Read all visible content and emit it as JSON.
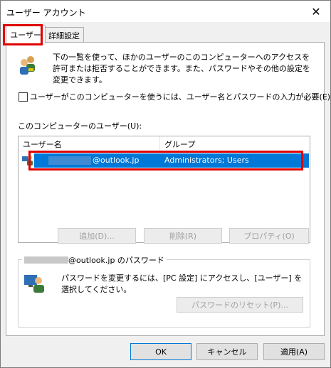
{
  "window": {
    "title": "ユーザー アカウント",
    "close_glyph": "✕"
  },
  "tabs": [
    {
      "label": "ユーザー",
      "active": true
    },
    {
      "label": "詳細設定",
      "active": false
    }
  ],
  "info_text": "下の一覧を使って、ほかのユーザーのこのコンピューターへのアクセスを許可または拒否することができます。また、パスワードやその他の設定を変更できます。",
  "require_login_checkbox": {
    "label": "ユーザーがこのコンピューターを使うには、ユーザー名とパスワードの入力が必要(E)",
    "checked": false
  },
  "users_section": {
    "label": "このコンピューターのユーザー(U):",
    "columns": [
      "ユーザー名",
      "グループ"
    ],
    "rows": [
      {
        "user_suffix": "@outlook.jp",
        "group": "Administrators; Users",
        "selected": true
      }
    ]
  },
  "list_buttons": {
    "add": "追加(D)...",
    "remove": "削除(R)",
    "properties": "プロパティ(O)"
  },
  "password_group": {
    "legend_suffix": "@outlook.jp のパスワード",
    "text": "パスワードを変更するには、[PC 設定] にアクセスし、[ユーザー] を選択してください。",
    "reset_button": "パスワードのリセット(P)..."
  },
  "footer": {
    "ok": "OK",
    "cancel": "キャンセル",
    "apply": "適用(A)"
  },
  "colors": {
    "selection": "#0078d7",
    "highlight_box": "#e00000"
  }
}
